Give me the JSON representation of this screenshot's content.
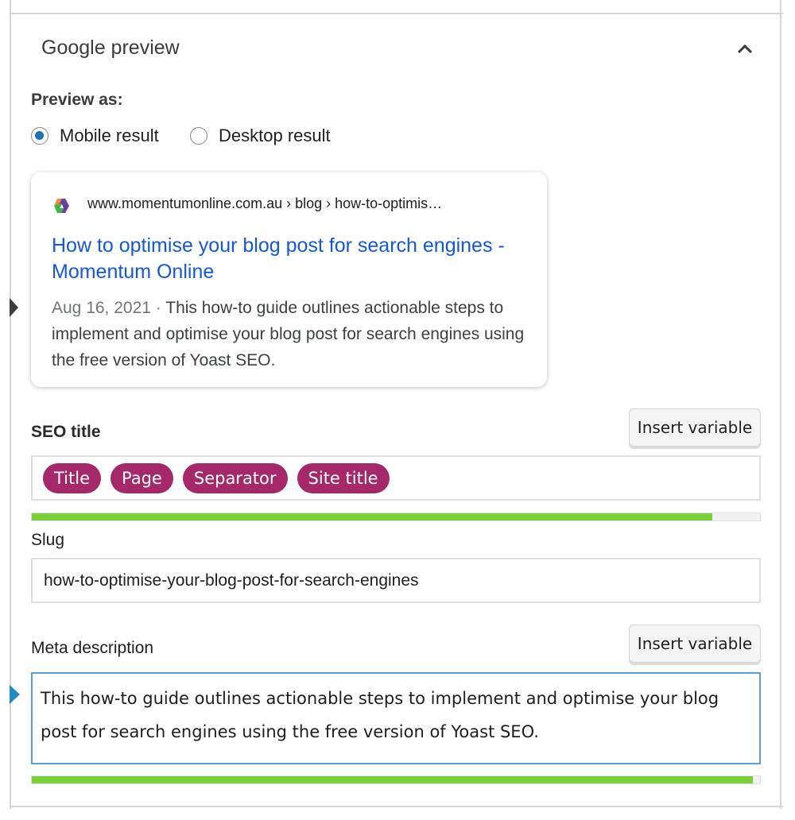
{
  "section": {
    "title": "Google preview",
    "collapse_icon": "chevron-up-icon"
  },
  "preview_as": {
    "label": "Preview as:",
    "options": [
      {
        "label": "Mobile result",
        "selected": true
      },
      {
        "label": "Desktop result",
        "selected": false
      }
    ]
  },
  "google_result": {
    "favicon": "momentum-online-logo-icon",
    "url": "www.momentumonline.com.au › blog › how-to-optimis…",
    "title": "How to optimise your blog post for search engines - Momentum Online",
    "date": "Aug 16, 2021",
    "separator": " · ",
    "snippet": "This how-to guide outlines actionable steps to implement and optimise your blog post for search engines using the free version of Yoast SEO."
  },
  "seo_title": {
    "label": "SEO title",
    "insert_variable_label": "Insert variable",
    "variables": [
      "Title",
      "Page",
      "Separator",
      "Site title"
    ],
    "progress_percent": 93.5,
    "progress_color": "#7ad03a"
  },
  "slug": {
    "label": "Slug",
    "value": "how-to-optimise-your-blog-post-for-search-engines"
  },
  "meta_description": {
    "label": "Meta description",
    "insert_variable_label": "Insert variable",
    "value": "This how-to guide outlines actionable steps to implement and optimise your blog post for search engines using the free version of Yoast SEO.",
    "progress_percent": 99,
    "progress_color": "#7ad03a"
  },
  "colors": {
    "accent": "#2271b1",
    "link_blue": "#1558d6",
    "pill": "#a4286a",
    "focus_border": "#5b9dd9"
  }
}
